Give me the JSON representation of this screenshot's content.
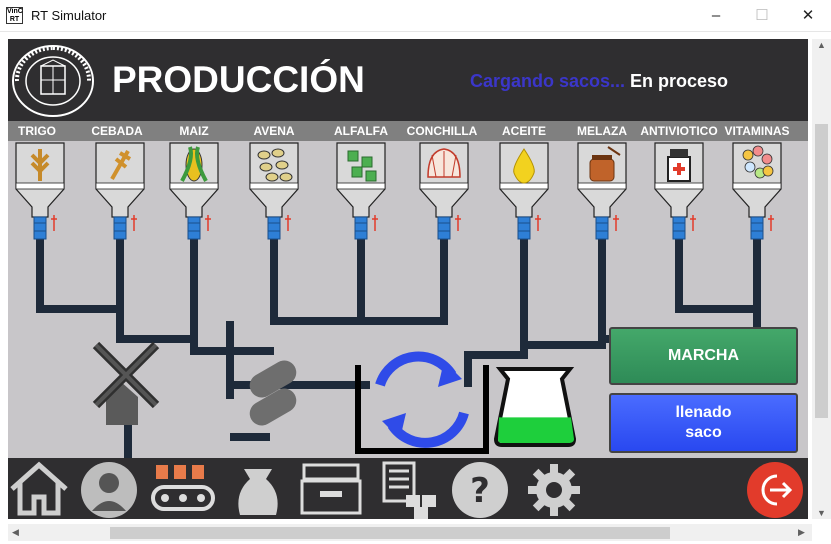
{
  "window": {
    "title": "RT Simulator",
    "app_icon_text": "VinC RT"
  },
  "header": {
    "title": "PRODUCCIÓN",
    "loading_text": "Cargando sacos...",
    "status": "En proceso"
  },
  "ingredients": [
    "TRIGO",
    "CEBADA",
    "MAIZ",
    "AVENA",
    "ALFALFA",
    "CONCHILLA",
    "ACEITE",
    "MELAZA",
    "ANTIVIOTICO",
    "VITAMINAS"
  ],
  "buttons": {
    "marcha": "MARCHA",
    "llenado_line1": "llenado",
    "llenado_line2": "saco"
  },
  "tank": {
    "fill_level": 0.4
  },
  "colors": {
    "header_bg": "#2f2e30",
    "panel_bg": "#c8c6c9",
    "pipe": "#1e2a3a",
    "marcha": "#2e8b57",
    "llenado": "#2948f0",
    "exit": "#e23b2b"
  },
  "toolbar_icons": [
    "home-icon",
    "user-icon",
    "conveyor-icon",
    "sack-icon",
    "archive-icon",
    "inventory-icon",
    "help-icon",
    "gear-icon",
    "exit-icon"
  ]
}
